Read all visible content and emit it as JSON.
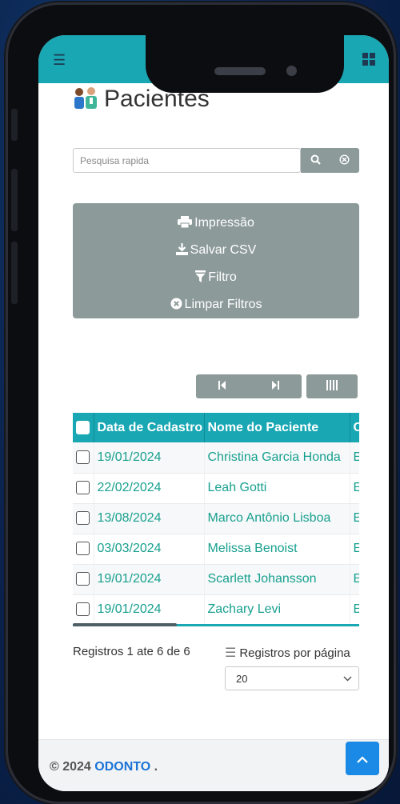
{
  "page": {
    "title": "Pacientes",
    "title_icon": "doctor-patient-icon"
  },
  "topbar": {
    "color": "#19a7b4",
    "icons": [
      "menu-icon",
      "user-icon",
      "compress-icon",
      "grid-icon"
    ]
  },
  "search": {
    "placeholder": "Pesquisa rapida",
    "value": ""
  },
  "actions": {
    "print_label": "Impressão",
    "csv_label": "Salvar CSV",
    "filter_label": "Filtro",
    "clear_filters_label": "Limpar Filtros"
  },
  "table": {
    "columns": [
      "Data de Cadastro",
      "Nome do Paciente",
      "C"
    ],
    "rows": [
      {
        "date": "19/01/2024",
        "name": "Christina Garcia Honda",
        "extra": "E"
      },
      {
        "date": "22/02/2024",
        "name": "Leah Gotti",
        "extra": "E"
      },
      {
        "date": "13/08/2024",
        "name": "Marco Antônio Lisboa",
        "extra": "E"
      },
      {
        "date": "03/03/2024",
        "name": "Melissa Benoist",
        "extra": "E"
      },
      {
        "date": "19/01/2024",
        "name": "Scarlett Johansson",
        "extra": "E"
      },
      {
        "date": "19/01/2024",
        "name": "Zachary Levi",
        "extra": "E"
      }
    ]
  },
  "pagination": {
    "records_info": "Registros 1 ate 6 de 6",
    "per_page_label": "Registros por página",
    "per_page_value": "20"
  },
  "footer": {
    "copyright": "© 2024 ",
    "brand": "ODONTO",
    "suffix": " ."
  },
  "colors": {
    "accent": "#19a7b4",
    "panel": "#8c9a99",
    "link_green": "#17a08f",
    "brand_blue": "#1a73d6"
  }
}
